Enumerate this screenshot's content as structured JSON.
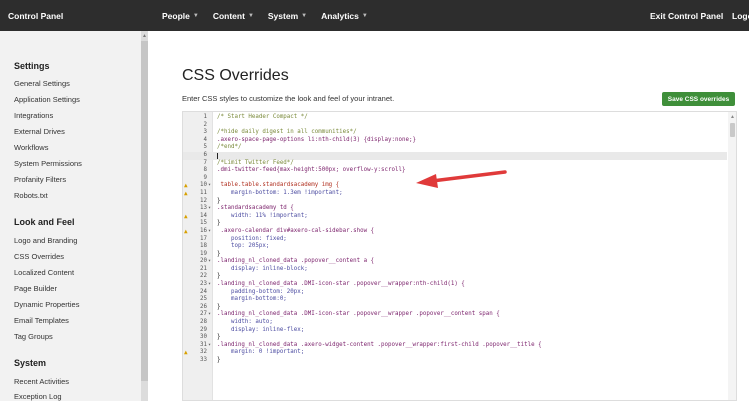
{
  "topbar": {
    "brand": "Control Panel",
    "nav": [
      "People",
      "Content",
      "System",
      "Analytics"
    ],
    "exit": "Exit Control Panel",
    "logout": "Logo"
  },
  "sidebar": {
    "sections": [
      {
        "heading": "Settings",
        "items": [
          "General Settings",
          "Application Settings",
          "Integrations",
          "External Drives",
          "Workflows",
          "System Permissions",
          "Profanity Filters",
          "Robots.txt"
        ]
      },
      {
        "heading": "Look and Feel",
        "items": [
          "Logo and Branding",
          "CSS Overrides",
          "Localized Content",
          "Page Builder",
          "Dynamic Properties",
          "Email Templates",
          "Tag Groups"
        ]
      },
      {
        "heading": "System",
        "items": [
          "Recent Activities",
          "Exception Log"
        ]
      }
    ]
  },
  "main": {
    "title": "CSS Overrides",
    "subtitle": "Enter CSS styles to customize the look and feel of your intranet.",
    "save_label": "Save CSS overrides"
  },
  "editor": {
    "lines": [
      {
        "n": "1",
        "text": "/* Start Header Compact */",
        "kind": "comment"
      },
      {
        "n": "2",
        "text": "",
        "kind": "plain"
      },
      {
        "n": "3",
        "text": "/*hide daily digest in all communities*/",
        "kind": "comment"
      },
      {
        "n": "4",
        "text": ".axero-space-page-options li:nth-child(3) {display:none;}",
        "kind": "sel"
      },
      {
        "n": "5",
        "text": "/*end*/",
        "kind": "comment"
      },
      {
        "n": "6",
        "text": "",
        "kind": "cursor"
      },
      {
        "n": "7",
        "text": "/*Limit Twitter Feed*/",
        "kind": "comment"
      },
      {
        "n": "8",
        "text": ".dmi-twitter-feed{max-height:500px; overflow-y:scroll}",
        "kind": "sel"
      },
      {
        "n": "9",
        "text": "",
        "kind": "plain"
      },
      {
        "n": "10",
        "text": " table.table.standardsacademy img {",
        "kind": "tag",
        "fold": true,
        "warn": true
      },
      {
        "n": "11",
        "text": "    margin-bottom: 1.3em !important;",
        "kind": "prop",
        "warn": true
      },
      {
        "n": "12",
        "text": "}",
        "kind": "plain"
      },
      {
        "n": "13",
        "text": ".standardsacademy td {",
        "kind": "sel",
        "fold": true
      },
      {
        "n": "14",
        "text": "    width: 11% !important;",
        "kind": "prop",
        "warn": true
      },
      {
        "n": "15",
        "text": "}",
        "kind": "plain"
      },
      {
        "n": "16",
        "text": " .axero-calendar div#axero-cal-sidebar.show {",
        "kind": "sel",
        "fold": true,
        "warn": true
      },
      {
        "n": "17",
        "text": "    position: fixed;",
        "kind": "prop"
      },
      {
        "n": "18",
        "text": "    top: 205px;",
        "kind": "prop"
      },
      {
        "n": "19",
        "text": "}",
        "kind": "plain"
      },
      {
        "n": "20",
        "text": ".landing_nl_cloned_data .popover__content a {",
        "kind": "sel",
        "fold": true
      },
      {
        "n": "21",
        "text": "    display: inline-block;",
        "kind": "prop"
      },
      {
        "n": "22",
        "text": "}",
        "kind": "plain"
      },
      {
        "n": "23",
        "text": ".landing_nl_cloned_data .DMI-icon-star .popover__wrapper:nth-child(1) {",
        "kind": "sel",
        "fold": true
      },
      {
        "n": "24",
        "text": "    padding-bottom: 20px;",
        "kind": "prop"
      },
      {
        "n": "25",
        "text": "    margin-bottom:0;",
        "kind": "prop"
      },
      {
        "n": "26",
        "text": "}",
        "kind": "plain"
      },
      {
        "n": "27",
        "text": ".landing_nl_cloned_data .DMI-icon-star .popover__wrapper .popover__content span {",
        "kind": "sel",
        "fold": true
      },
      {
        "n": "28",
        "text": "    width: auto;",
        "kind": "prop"
      },
      {
        "n": "29",
        "text": "    display: inline-flex;",
        "kind": "prop"
      },
      {
        "n": "30",
        "text": "}",
        "kind": "plain"
      },
      {
        "n": "31",
        "text": ".landing_nl_cloned_data .axero-widget-content .popover__wrapper:first-child .popover__title {",
        "kind": "sel",
        "fold": true
      },
      {
        "n": "32",
        "text": "    margin: 0 !important;",
        "kind": "prop",
        "warn": true
      },
      {
        "n": "33",
        "text": "}",
        "kind": "plain"
      }
    ]
  },
  "colors": {
    "topbar_bg": "#2d2d2d",
    "accent_green": "#3f8f3a",
    "arrow_red": "#e03a3a"
  }
}
